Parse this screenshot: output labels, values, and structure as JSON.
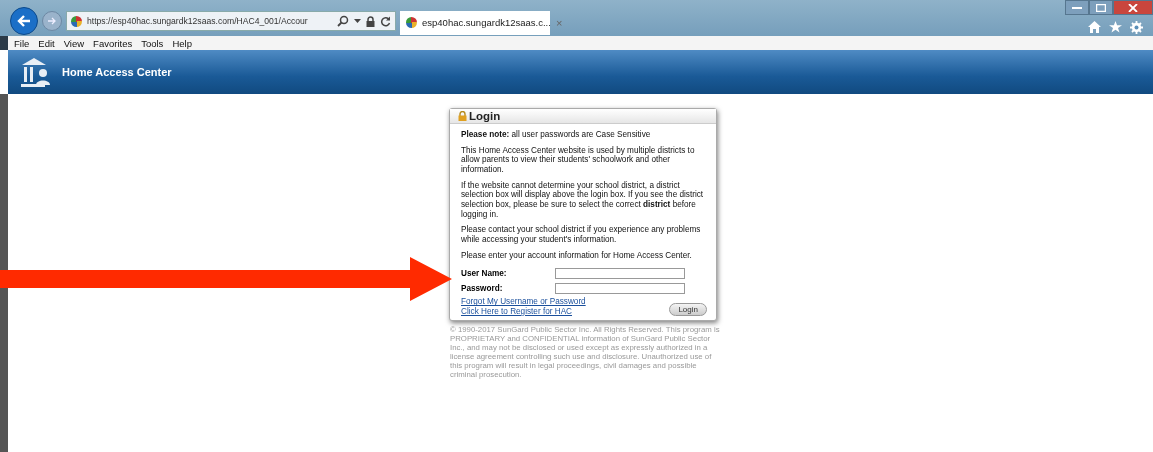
{
  "browser": {
    "address": "https://esp40hac.sungardk12saas.com/HAC4_001/Accour",
    "tab_title": "esp40hac.sungardk12saas.c...",
    "tab_close": "×"
  },
  "menu": [
    "File",
    "Edit",
    "View",
    "Favorites",
    "Tools",
    "Help"
  ],
  "header": {
    "title": "Home Access Center"
  },
  "login": {
    "title": "Login",
    "paragraphs": [
      "**Please note:** all user passwords are Case Sensitive",
      "This Home Access Center website is used by multiple districts to allow parents to view their students' schoolwork and other information.",
      "If the website cannot determine your school district, a district selection box will display above the login box. If you see the district selection box, please be sure to select the correct **district** before logging in.",
      "Please contact your school district if you experience any problems while accessing your student's information.",
      "Please enter your account information for Home Access Center."
    ],
    "fields": [
      {
        "label": "User Name:"
      },
      {
        "label": "Password:"
      }
    ],
    "links": [
      "Forgot My Username or Password",
      "Click Here to Register for HAC"
    ],
    "button": "Login"
  },
  "copyright": "© 1990-2017 SunGard Public Sector Inc. All Rights Reserved. This program is PROPRIETARY and CONFIDENTIAL information of SunGard Public Sector Inc., and may not be disclosed or used except as expressly authorized in a license agreement controlling such use and disclosure. Unauthorized use of this program will result in legal proceedings, civil damages and possible criminal prosecution."
}
